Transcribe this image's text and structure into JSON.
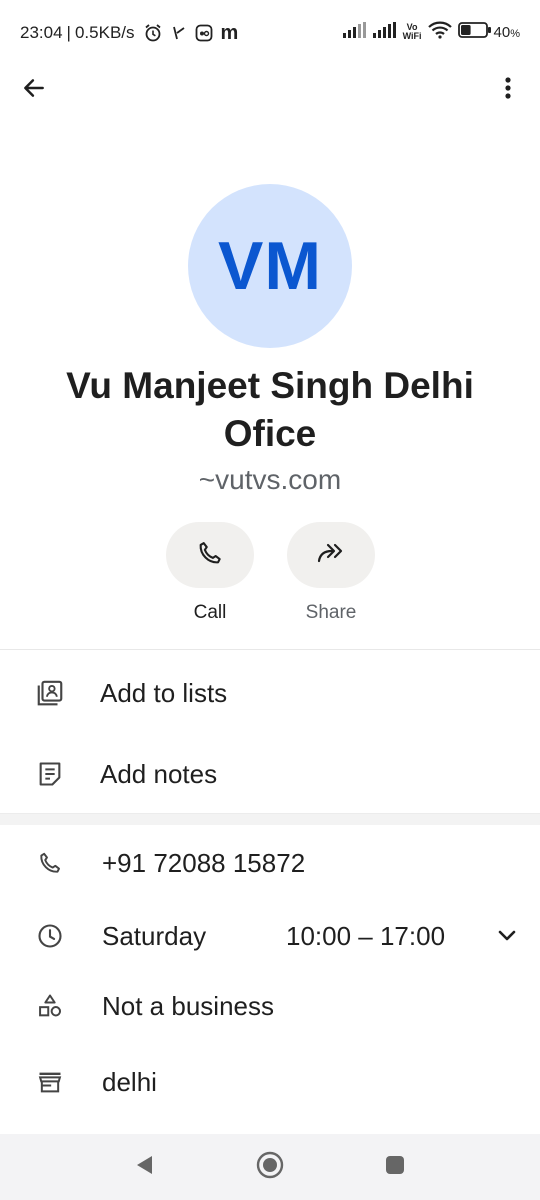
{
  "status_bar": {
    "time": "23:04",
    "separator": "|",
    "net_speed": "0.5KB/s",
    "app_icon_letter": "m",
    "vowifi_top": "Vo",
    "vowifi_bottom": "WiFi",
    "battery": "40",
    "battery_unit": "%",
    "battery_level": 0.4
  },
  "contact": {
    "initials": "VM",
    "name": "Vu Manjeet Singh Delhi Ofice",
    "subtitle": "~vutvs.com"
  },
  "actions": {
    "call_label": "Call",
    "share_label": "Share"
  },
  "menu": {
    "add_to_lists": "Add to lists",
    "add_notes": "Add notes"
  },
  "details": {
    "phone": "+91 72088 15872",
    "hours_day": "Saturday",
    "hours_time": "10:00 – 17:00",
    "business_type": "Not a business",
    "location": "delhi"
  },
  "colors": {
    "avatar_bg": "#d3e3fd",
    "avatar_text": "#0b57d0",
    "pill_bg": "#f1f0ee"
  }
}
